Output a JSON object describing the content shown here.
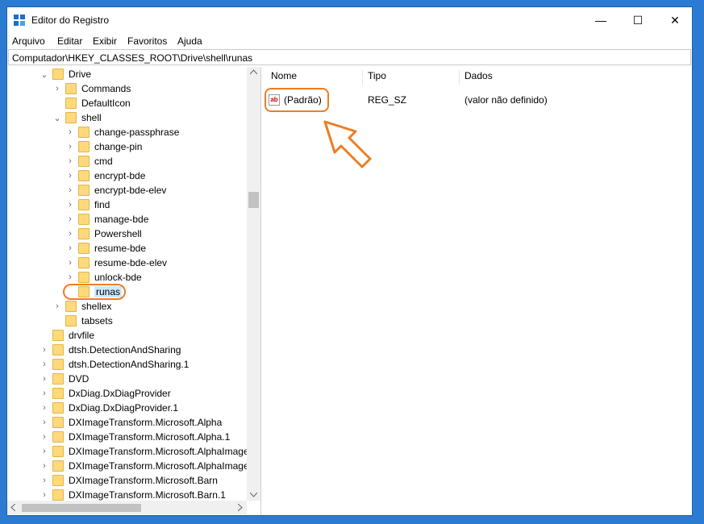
{
  "window": {
    "title": "Editor do Registro",
    "min": "—",
    "max": "☐",
    "close": "✕"
  },
  "menu": [
    "Arquivo",
    "Editar",
    "Exibir",
    "Favoritos",
    "Ajuda"
  ],
  "address": "Computador\\HKEY_CLASSES_ROOT\\Drive\\shell\\runas",
  "tree": [
    {
      "label": "Drive",
      "level": 0,
      "expander": "open"
    },
    {
      "label": "Commands",
      "level": 1,
      "expander": "closed"
    },
    {
      "label": "DefaultIcon",
      "level": 1,
      "expander": "none"
    },
    {
      "label": "shell",
      "level": 1,
      "expander": "open"
    },
    {
      "label": "change-passphrase",
      "level": 2,
      "expander": "closed"
    },
    {
      "label": "change-pin",
      "level": 2,
      "expander": "closed"
    },
    {
      "label": "cmd",
      "level": 2,
      "expander": "closed"
    },
    {
      "label": "encrypt-bde",
      "level": 2,
      "expander": "closed"
    },
    {
      "label": "encrypt-bde-elev",
      "level": 2,
      "expander": "closed"
    },
    {
      "label": "find",
      "level": 2,
      "expander": "closed"
    },
    {
      "label": "manage-bde",
      "level": 2,
      "expander": "closed"
    },
    {
      "label": "Powershell",
      "level": 2,
      "expander": "closed"
    },
    {
      "label": "resume-bde",
      "level": 2,
      "expander": "closed"
    },
    {
      "label": "resume-bde-elev",
      "level": 2,
      "expander": "closed"
    },
    {
      "label": "unlock-bde",
      "level": 2,
      "expander": "closed"
    },
    {
      "label": "runas",
      "level": 2,
      "expander": "none",
      "selected": true
    },
    {
      "label": "shellex",
      "level": 1,
      "expander": "closed"
    },
    {
      "label": "tabsets",
      "level": 1,
      "expander": "none"
    },
    {
      "label": "drvfile",
      "level": 0,
      "expander": "none"
    },
    {
      "label": "dtsh.DetectionAndSharing",
      "level": 0,
      "expander": "closed"
    },
    {
      "label": "dtsh.DetectionAndSharing.1",
      "level": 0,
      "expander": "closed"
    },
    {
      "label": "DVD",
      "level": 0,
      "expander": "closed"
    },
    {
      "label": "DxDiag.DxDiagProvider",
      "level": 0,
      "expander": "closed"
    },
    {
      "label": "DxDiag.DxDiagProvider.1",
      "level": 0,
      "expander": "closed"
    },
    {
      "label": "DXImageTransform.Microsoft.Alpha",
      "level": 0,
      "expander": "closed"
    },
    {
      "label": "DXImageTransform.Microsoft.Alpha.1",
      "level": 0,
      "expander": "closed"
    },
    {
      "label": "DXImageTransform.Microsoft.AlphaImage",
      "level": 0,
      "expander": "closed"
    },
    {
      "label": "DXImageTransform.Microsoft.AlphaImage",
      "level": 0,
      "expander": "closed"
    },
    {
      "label": "DXImageTransform.Microsoft.Barn",
      "level": 0,
      "expander": "closed"
    },
    {
      "label": "DXImageTransform.Microsoft.Barn.1",
      "level": 0,
      "expander": "closed"
    }
  ],
  "columns": {
    "name": "Nome",
    "type": "Tipo",
    "data": "Dados"
  },
  "values": [
    {
      "icon": "ab",
      "name": "(Padrão)",
      "type": "REG_SZ",
      "data": "(valor não definido)"
    }
  ],
  "colors": {
    "accent": "#ee7d22",
    "selection": "#cce8ff",
    "titlebar_icon": "#1f6fc5"
  }
}
